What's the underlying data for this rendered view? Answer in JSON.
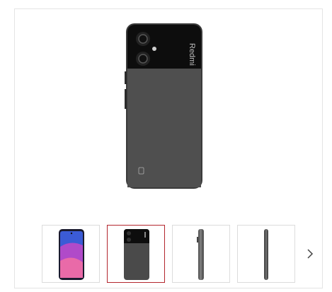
{
  "product_gallery": {
    "main_image": {
      "icon": "phone-back-image",
      "brand_text": "Redmi"
    },
    "thumbnails": [
      {
        "icon": "phone-front-image",
        "selected": false
      },
      {
        "icon": "phone-back-image",
        "selected": true
      },
      {
        "icon": "phone-side-image",
        "selected": false
      },
      {
        "icon": "phone-side-image",
        "selected": false
      }
    ],
    "next_icon": "chevron-right-icon",
    "colors": {
      "selected_border": "#b3262d",
      "border": "#dcdcdc"
    }
  }
}
